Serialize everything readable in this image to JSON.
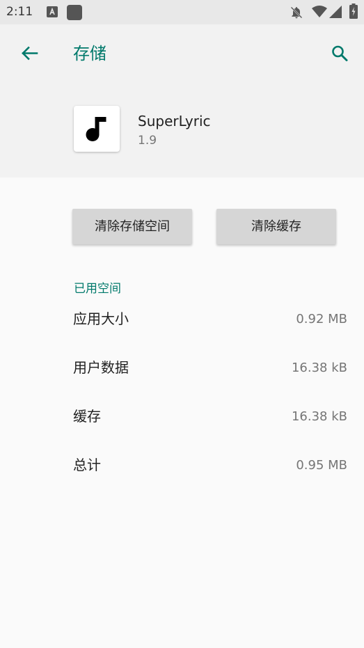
{
  "status_bar": {
    "time": "2:11",
    "icons": [
      "a-notification-icon",
      "app-notification-icon",
      "notifications-off-icon",
      "wifi-icon",
      "signal-icon",
      "battery-icon"
    ]
  },
  "app_bar": {
    "back_icon": "arrow-back-icon",
    "title": "存储",
    "search_icon": "search-icon"
  },
  "app_info": {
    "icon": "music-note-icon",
    "name": "SuperLyric",
    "version": "1.9"
  },
  "actions": {
    "clear_storage": "清除存储空间",
    "clear_cache": "清除缓存"
  },
  "usage": {
    "header": "已用空间",
    "rows": [
      {
        "label": "应用大小",
        "value": "0.92 MB"
      },
      {
        "label": "用户数据",
        "value": "16.38 kB"
      },
      {
        "label": "缓存",
        "value": "16.38 kB"
      },
      {
        "label": "总计",
        "value": "0.95 MB"
      }
    ]
  },
  "colors": {
    "accent": "#00796b",
    "button_bg": "#d6d6d6",
    "header_bg": "#f2f2f2",
    "page_bg": "#fafafa",
    "status_bg": "#e8e8e8"
  }
}
